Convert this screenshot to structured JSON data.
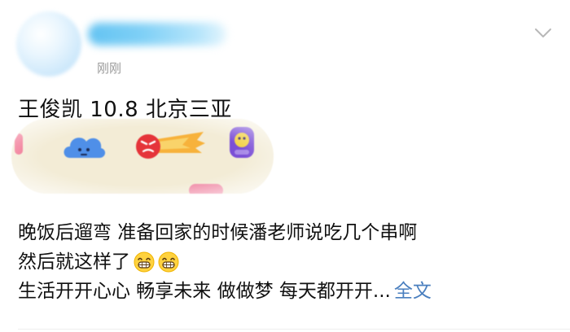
{
  "post": {
    "time": "刚刚",
    "title": "王俊凯 10.8 北京三亚",
    "lines": [
      "晚饭后遛弯 准备回家的时候潘老师说吃几个串啊",
      "然后就这样了",
      "生活开开心心 畅享未来 做做梦 每天都开开..."
    ],
    "more_label": "全文"
  },
  "icons": {
    "chevron": "chevron-down-icon",
    "emoji": "grinning-face-emoji-icon"
  },
  "colors": {
    "link": "#4a7fbf",
    "time": "#9a9a9a",
    "banner_bg": "#f3ecd6"
  }
}
